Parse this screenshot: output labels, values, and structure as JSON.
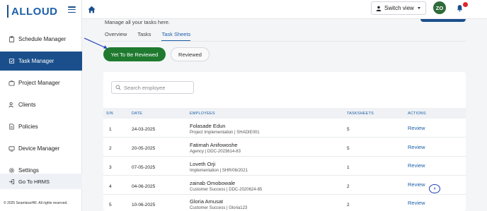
{
  "app": {
    "logo_text": "ALLOUD"
  },
  "sidebar": {
    "items": [
      {
        "label": "Schedule Manager",
        "icon": "clipboard-icon"
      },
      {
        "label": "Task Manager",
        "icon": "task-icon",
        "active": true
      },
      {
        "label": "Project Manager",
        "icon": "briefcase-icon"
      },
      {
        "label": "Clients",
        "icon": "users-icon"
      },
      {
        "label": "Policies",
        "icon": "document-icon"
      },
      {
        "label": "Device Manager",
        "icon": "device-icon"
      },
      {
        "label": "Settings",
        "icon": "gear-icon"
      }
    ],
    "goto_label": "Go To HRMS",
    "copyright": "© 2025 SeamlessHR. All rights reserved."
  },
  "header": {
    "switch_view_label": "Switch view",
    "avatar_initials": "ZO"
  },
  "main": {
    "subtitle": "Manage all your tasks here.",
    "tabs": [
      {
        "label": "Overview"
      },
      {
        "label": "Tasks"
      },
      {
        "label": "Task Sheets",
        "active": true
      }
    ],
    "filters": {
      "yet_to_review": "Yet To Be Reviewed",
      "reviewed": "Reviewed"
    },
    "search": {
      "placeholder": "Search employee",
      "value": ""
    },
    "table": {
      "columns": [
        "S/N",
        "DATE",
        "EMPLOYEES",
        "TASKSHEETS",
        "ACTIONS"
      ],
      "rows": [
        {
          "sn": "1",
          "date": "24-03-2025",
          "name": "Folasade Edun",
          "sub": "Project Implementation | SHADIE001",
          "tasksheets": "5",
          "action": "Review"
        },
        {
          "sn": "2",
          "date": "20-05-2025",
          "name": "Fatimah Anifowoshe",
          "sub": "Agency | DDC-2023614-83",
          "tasksheets": "5",
          "action": "Review"
        },
        {
          "sn": "3",
          "date": "07-05-2025",
          "name": "Loveth Orji",
          "sub": "Implementation | SHR/06/2021",
          "tasksheets": "1",
          "action": "Review"
        },
        {
          "sn": "4",
          "date": "04-06-2025",
          "name": "zainab Omobowale",
          "sub": "Customer Success | DDC-2020624-85",
          "tasksheets": "2",
          "action": "Review"
        },
        {
          "sn": "5",
          "date": "10-06-2025",
          "name": "Gloria Amusat",
          "sub": "Customer Success | Gloria123",
          "tasksheets": "2",
          "action": "Review"
        }
      ]
    },
    "marker_label": "4"
  },
  "colors": {
    "primary": "#1a4f8b",
    "link": "#1d5fa8",
    "green_button": "#1f7a2f",
    "avatar_bg": "#2f6b3a",
    "notification": "#e0262b",
    "annotation": "#1e3fb8"
  }
}
